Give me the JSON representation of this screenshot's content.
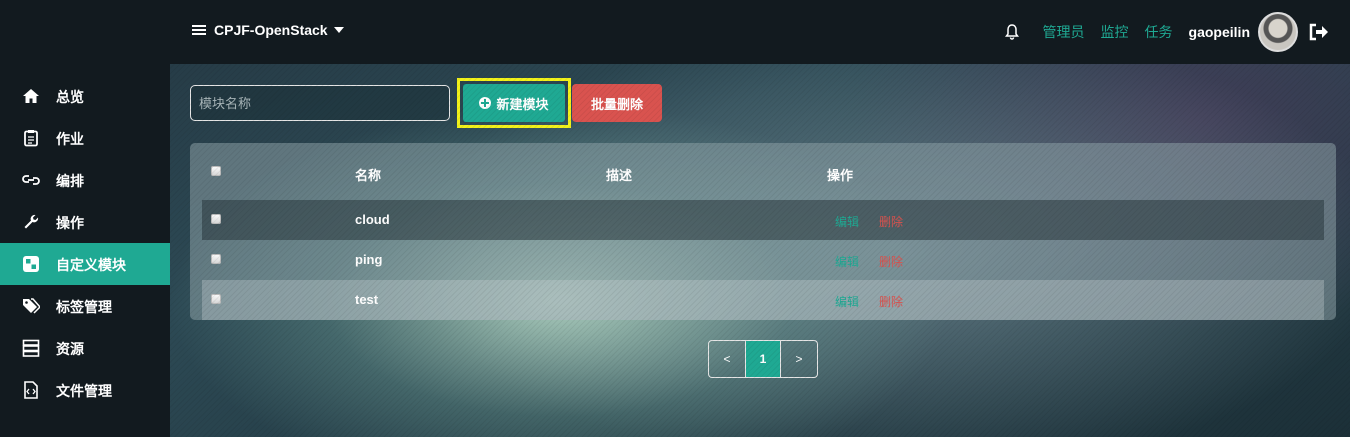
{
  "header": {
    "project": "CPJF-OpenStack",
    "links": [
      "管理员",
      "监控",
      "任务"
    ],
    "username": "gaopeilin"
  },
  "sidebar": {
    "items": [
      {
        "label": "总览",
        "icon": "home-icon"
      },
      {
        "label": "作业",
        "icon": "clipboard-icon"
      },
      {
        "label": "编排",
        "icon": "link-icon"
      },
      {
        "label": "操作",
        "icon": "wrench-icon"
      },
      {
        "label": "自定义模块",
        "icon": "module-icon",
        "active": true
      },
      {
        "label": "标签管理",
        "icon": "tags-icon"
      },
      {
        "label": "资源",
        "icon": "server-icon"
      },
      {
        "label": "文件管理",
        "icon": "file-code-icon"
      }
    ]
  },
  "toolbar": {
    "search_placeholder": "模块名称",
    "search_value": "",
    "new_label": "新建模块",
    "batch_delete_label": "批量删除"
  },
  "table": {
    "columns": [
      "名称",
      "描述",
      "操作"
    ],
    "rows": [
      {
        "name": "cloud",
        "description": "",
        "edit": "编辑",
        "delete": "删除"
      },
      {
        "name": "ping",
        "description": "",
        "edit": "编辑",
        "delete": "删除"
      },
      {
        "name": "test",
        "description": "",
        "edit": "编辑",
        "delete": "删除"
      }
    ]
  },
  "pagination": {
    "prev": "<",
    "current": "1",
    "next": ">"
  },
  "colors": {
    "accent": "#1fa993",
    "danger": "#d9534f",
    "highlight": "#f2f21a",
    "nav_bg": "#121a1f"
  }
}
